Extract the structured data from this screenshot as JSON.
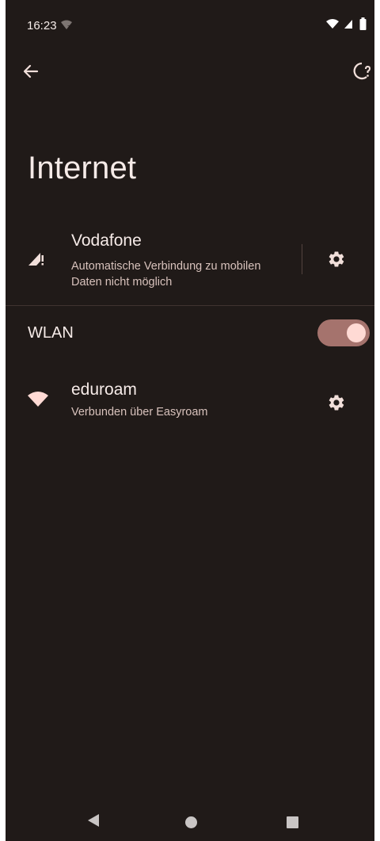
{
  "status_bar": {
    "time": "16:23",
    "icons": [
      "wifi-question-icon",
      "wifi-full-icon",
      "signal-no-data-icon",
      "battery-icon"
    ]
  },
  "app_bar": {
    "back_icon": "arrow-back-icon",
    "help_icon": "help-feedback-icon"
  },
  "title": "Internet",
  "mobile_network": {
    "name": "Vodafone",
    "status": "Automatische Verbindung zu mobilen Daten nicht möglich",
    "icon": "signal-no-data-icon",
    "settings_icon": "gear-icon"
  },
  "wlan": {
    "label": "WLAN",
    "enabled": true
  },
  "networks": [
    {
      "name": "eduroam",
      "status": "Verbunden über Easyroam",
      "icon": "wifi-full-icon",
      "settings_icon": "gear-icon"
    }
  ],
  "nav_bar": {
    "buttons": [
      "nav-back-icon",
      "nav-home-icon",
      "nav-recents-icon"
    ]
  },
  "colors": {
    "background": "#201a18",
    "text_primary": "#f6ebe8",
    "text_secondary": "#d8c2bc",
    "switch_track": "#a5736d",
    "switch_thumb": "#ffdad4",
    "wifi_icon": "#ffdad4"
  }
}
